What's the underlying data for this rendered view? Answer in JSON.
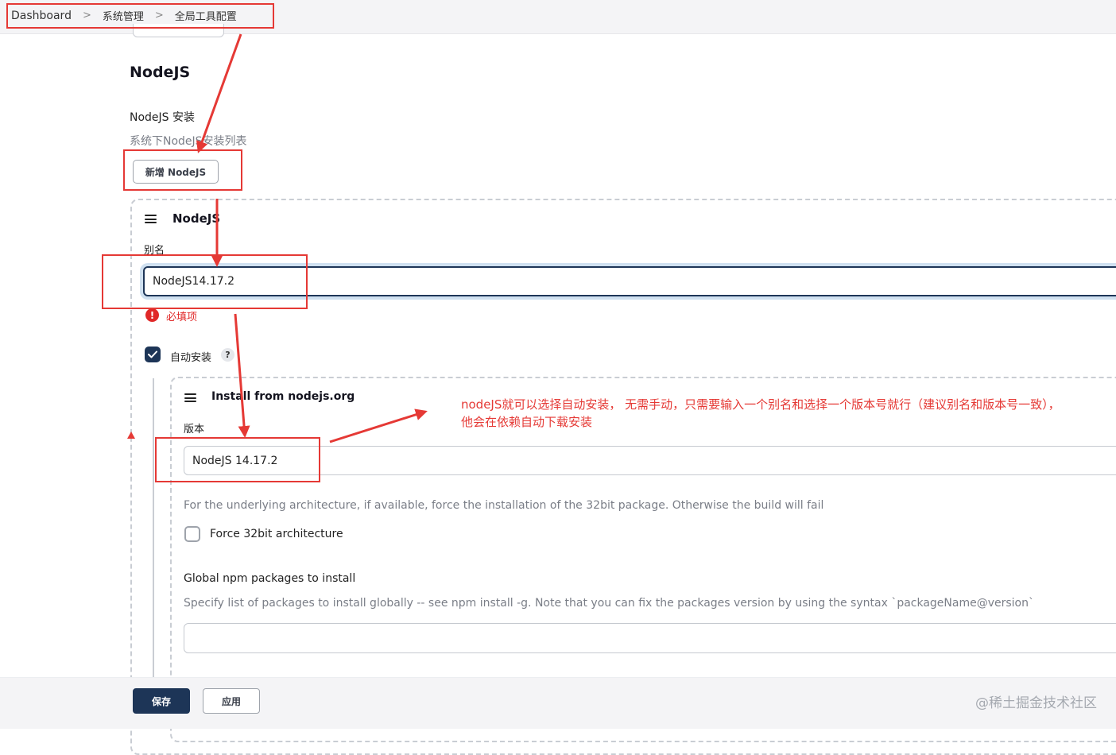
{
  "breadcrumb": {
    "items": [
      "Dashboard",
      "系统管理",
      "全局工具配置"
    ],
    "separator": ">"
  },
  "section": {
    "title": "NodeJS",
    "install_label": "NodeJS 安装",
    "install_desc": "系统下NodeJS安装列表",
    "add_button": "新增 NodeJS"
  },
  "installation": {
    "header": "NodeJS",
    "alias_label": "别名",
    "alias_value": "NodeJS14.17.2",
    "required_text": "必填项",
    "auto_install_label": "自动安装",
    "auto_install_checked": true,
    "help_glyph": "?"
  },
  "installer": {
    "header": "Install from nodejs.org",
    "version_label": "版本",
    "version_value": "NodeJS 14.17.2",
    "force32_desc": "For the underlying architecture, if available, force the installation of the 32bit package. Otherwise the build will fail",
    "force32_label": "Force 32bit architecture",
    "force32_checked": false,
    "npm_label": "Global npm packages to install",
    "npm_desc": "Specify list of packages to install globally -- see npm install -g. Note that you can fix the packages version by using the syntax `packageName@version`",
    "npm_value": ""
  },
  "annotation": {
    "line1": "nodeJS就可以选择自动安装， 无需手动，只需要输入一个别名和选择一个版本号就行（建议别名和版本号一致），",
    "line2": "他会在依赖自动下载安装",
    "color": "#e53935"
  },
  "footer": {
    "save": "保存",
    "apply": "应用"
  },
  "watermark": "@稀土掘金技术社区",
  "colors": {
    "primary": "#1d3557",
    "error": "#e02828",
    "annotation": "#e53935"
  }
}
